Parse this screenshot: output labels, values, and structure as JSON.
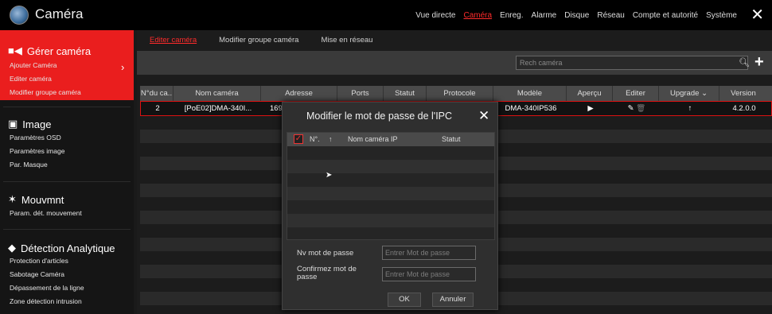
{
  "app": {
    "title": "Caméra"
  },
  "menu": [
    "Vue directe",
    "Caméra",
    "Enreg.",
    "Alarme",
    "Disque",
    "Réseau",
    "Compte et autorité",
    "Système"
  ],
  "sidebar": {
    "groups": [
      {
        "title": "Gérer caméra",
        "items": [
          "Ajouter Caméra",
          "Editer caméra",
          "Modifier groupe caméra"
        ]
      },
      {
        "title": "Image",
        "items": [
          "Paramètres OSD",
          "Paramètres image",
          "Par. Masque"
        ]
      },
      {
        "title": "Mouvmnt",
        "items": [
          "Param. dét. mouvement"
        ]
      },
      {
        "title": "Détection Analytique",
        "items": [
          "Protection d'articles",
          "Sabotage Caméra",
          "Dépassement de la ligne",
          "Zone détection intrusion"
        ]
      }
    ]
  },
  "subtabs": [
    "Editer caméra",
    "Modifier groupe caméra",
    "Mise en réseau"
  ],
  "search": {
    "placeholder": "Rech caméra"
  },
  "table": {
    "headers": [
      "N°du ca..",
      "Nom caméra",
      "Adresse",
      "Ports",
      "Statut",
      "Protocole",
      "Modèle",
      "Aperçu",
      "Editer",
      "Upgrade",
      "Version"
    ],
    "row": {
      "num": "2",
      "name": "[PoE02]DMA-340I...",
      "address": "169",
      "model": "DMA-340IP536",
      "version": "4.2.0.0"
    }
  },
  "dialog": {
    "title": "Modifier le mot de passe de l'IPC",
    "headers": [
      "N°.",
      "Nom caméra IP",
      "Statut"
    ],
    "new_password_label": "Nv mot de passe",
    "confirm_label": "Confirmez mot de passe",
    "new_password_placeholder": "Entrer Mot de passe",
    "confirm_placeholder": "Entrer Mot de passe",
    "ok": "OK",
    "cancel": "Annuler"
  },
  "colors": {
    "accent": "#ea1e1e",
    "background": "#1a1a1a",
    "active_menu": "#ff2b2b"
  }
}
